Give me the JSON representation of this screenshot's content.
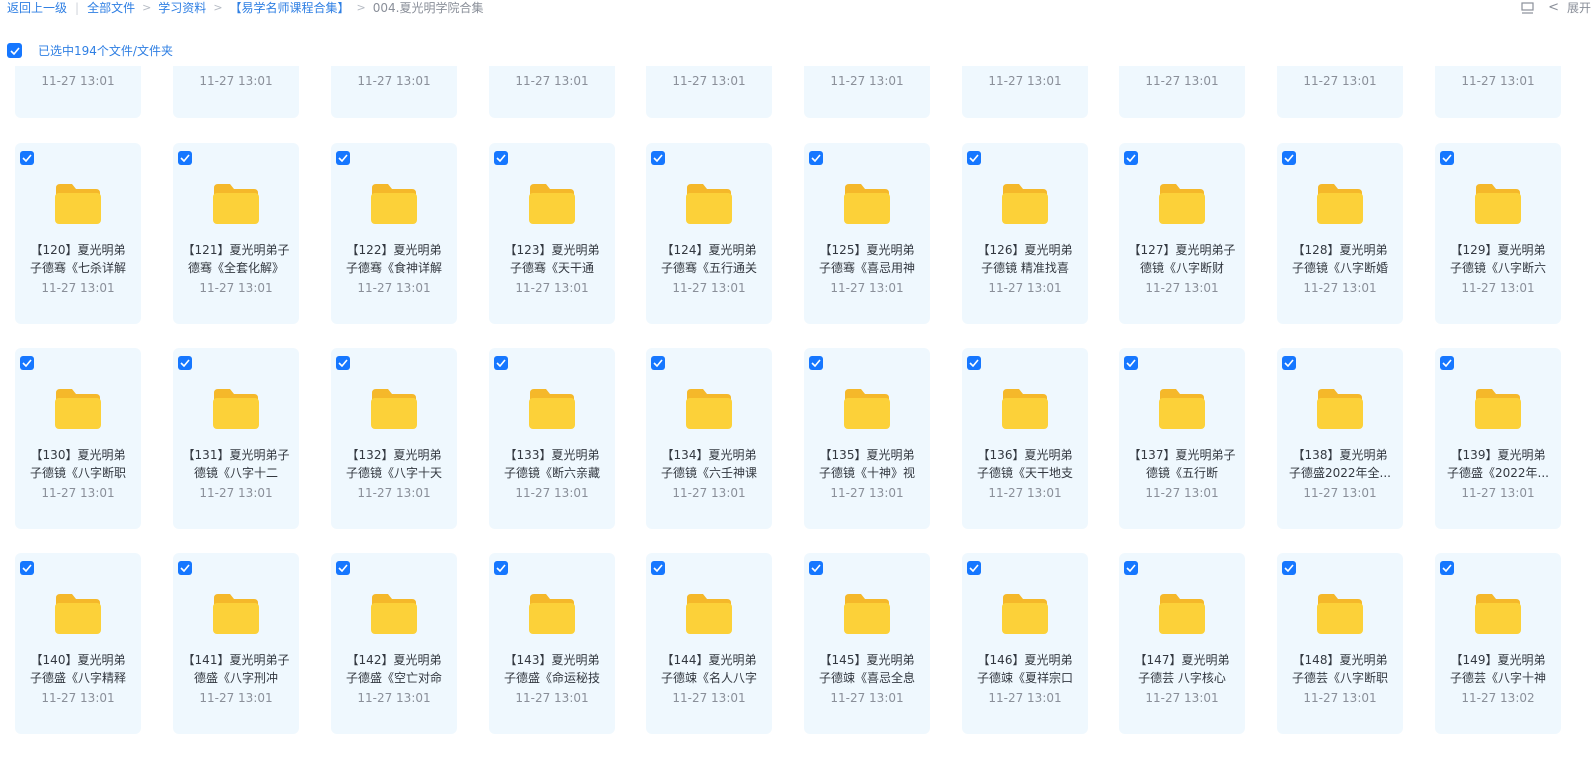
{
  "breadcrumb": {
    "back": "返回上一级",
    "items": [
      "全部文件",
      "学习资料",
      "【易学名师课程合集】"
    ],
    "current": "004.夏光明学院合集"
  },
  "topbar_right": {
    "list_icon": "list-view-icon",
    "collapse_label": "展开"
  },
  "selection": {
    "label": "已选中194个文件/文件夹"
  },
  "partial_row": {
    "dates": [
      "11-27 13:01",
      "11-27 13:01",
      "11-27 13:01",
      "11-27 13:01",
      "11-27 13:01",
      "11-27 13:01",
      "11-27 13:01",
      "11-27 13:01",
      "11-27 13:01",
      "11-27 13:01"
    ]
  },
  "folders": [
    {
      "line1": "【120】夏光明弟",
      "line2": "子德骞《七杀详解",
      "date": "11-27 13:01"
    },
    {
      "line1": "【121】夏光明弟子",
      "line2": "德骞《全套化解》",
      "date": "11-27 13:01"
    },
    {
      "line1": "【122】夏光明弟",
      "line2": "子德骞《食神详解",
      "date": "11-27 13:01"
    },
    {
      "line1": "【123】夏光明弟",
      "line2": "子德骞《天干通",
      "date": "11-27 13:01"
    },
    {
      "line1": "【124】夏光明弟",
      "line2": "子德骞《五行通关",
      "date": "11-27 13:01"
    },
    {
      "line1": "【125】夏光明弟",
      "line2": "子德骞《喜忌用神",
      "date": "11-27 13:01"
    },
    {
      "line1": "【126】夏光明弟",
      "line2": "子德镜 精准找喜",
      "date": "11-27 13:01"
    },
    {
      "line1": "【127】夏光明弟子",
      "line2": "德镜《八字断财",
      "date": "11-27 13:01"
    },
    {
      "line1": "【128】夏光明弟",
      "line2": "子德镜《八字断婚",
      "date": "11-27 13:01"
    },
    {
      "line1": "【129】夏光明弟",
      "line2": "子德镜《八字断六",
      "date": "11-27 13:01"
    },
    {
      "line1": "【130】夏光明弟",
      "line2": "子德镜《八字断职",
      "date": "11-27 13:01"
    },
    {
      "line1": "【131】夏光明弟子",
      "line2": "德镜《八字十二",
      "date": "11-27 13:01"
    },
    {
      "line1": "【132】夏光明弟",
      "line2": "子德镜《八字十天",
      "date": "11-27 13:01"
    },
    {
      "line1": "【133】夏光明弟",
      "line2": "子德镜《断六亲藏",
      "date": "11-27 13:01"
    },
    {
      "line1": "【134】夏光明弟",
      "line2": "子德镜《六壬神课",
      "date": "11-27 13:01"
    },
    {
      "line1": "【135】夏光明弟",
      "line2": "子德镜《十神》视",
      "date": "11-27 13:01"
    },
    {
      "line1": "【136】夏光明弟",
      "line2": "子德镜《天干地支",
      "date": "11-27 13:01"
    },
    {
      "line1": "【137】夏光明弟子",
      "line2": "德镜《五行断",
      "date": "11-27 13:01"
    },
    {
      "line1": "【138】夏光明弟",
      "line2": "子德盛2022年全...",
      "date": "11-27 13:01"
    },
    {
      "line1": "【139】夏光明弟",
      "line2": "子德盛《2022年...",
      "date": "11-27 13:01"
    },
    {
      "line1": "【140】夏光明弟",
      "line2": "子德盛《八字精释",
      "date": "11-27 13:01"
    },
    {
      "line1": "【141】夏光明弟子",
      "line2": "德盛《八字刑冲",
      "date": "11-27 13:01"
    },
    {
      "line1": "【142】夏光明弟",
      "line2": "子德盛《空亡对命",
      "date": "11-27 13:01"
    },
    {
      "line1": "【143】夏光明弟",
      "line2": "子德盛《命运秘技",
      "date": "11-27 13:01"
    },
    {
      "line1": "【144】夏光明弟",
      "line2": "子德竦《名人八字",
      "date": "11-27 13:01"
    },
    {
      "line1": "【145】夏光明弟",
      "line2": "子德竦《喜忌全息",
      "date": "11-27 13:01"
    },
    {
      "line1": "【146】夏光明弟",
      "line2": "子德竦《夏祥宗口",
      "date": "11-27 13:01"
    },
    {
      "line1": "【147】夏光明弟",
      "line2": "子德芸 八字核心",
      "date": "11-27 13:01"
    },
    {
      "line1": "【148】夏光明弟",
      "line2": "子德芸《八字断职",
      "date": "11-27 13:01"
    },
    {
      "line1": "【149】夏光明弟",
      "line2": "子德芸《八字十神",
      "date": "11-27 13:02"
    }
  ],
  "colors": {
    "accent": "#1677ff",
    "link": "#2f7fe3",
    "card_bg": "#eff8fe",
    "folder_body": "#fcd139",
    "folder_tab": "#f5b82a"
  }
}
